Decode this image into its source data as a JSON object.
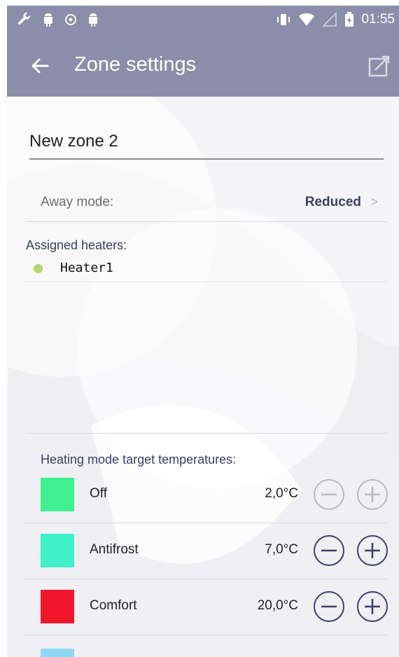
{
  "status_bar": {
    "time": "01:55",
    "icons": [
      "wrench-icon",
      "android-icon",
      "shield-icon",
      "android-icon",
      "vibrate-icon",
      "wifi-icon",
      "signal-icon",
      "battery-icon"
    ]
  },
  "app_bar": {
    "title": "Zone settings",
    "back_icon": "arrow-left-icon",
    "action_icon": "edit-share-icon",
    "color": "#8a8ea8"
  },
  "zone": {
    "name_value": "New zone 2"
  },
  "away_mode": {
    "label": "Away mode:",
    "value": "Reduced",
    "chevron": ">"
  },
  "assigned_heaters": {
    "label": "Assigned heaters:",
    "items": [
      {
        "name": "Heater1",
        "status_color": "#b6d66a"
      }
    ]
  },
  "heating_modes": {
    "label": "Heating mode target temperatures:",
    "items": [
      {
        "name": "Off",
        "temperature": "2,0°C",
        "color": "#3ef08f",
        "controls_enabled": false
      },
      {
        "name": "Antifrost",
        "temperature": "7,0°C",
        "color": "#3ff0c8",
        "controls_enabled": true
      },
      {
        "name": "Comfort",
        "temperature": "20,0°C",
        "color": "#f0172a",
        "controls_enabled": true
      }
    ],
    "partial_next_color": "#8fd6f4"
  }
}
